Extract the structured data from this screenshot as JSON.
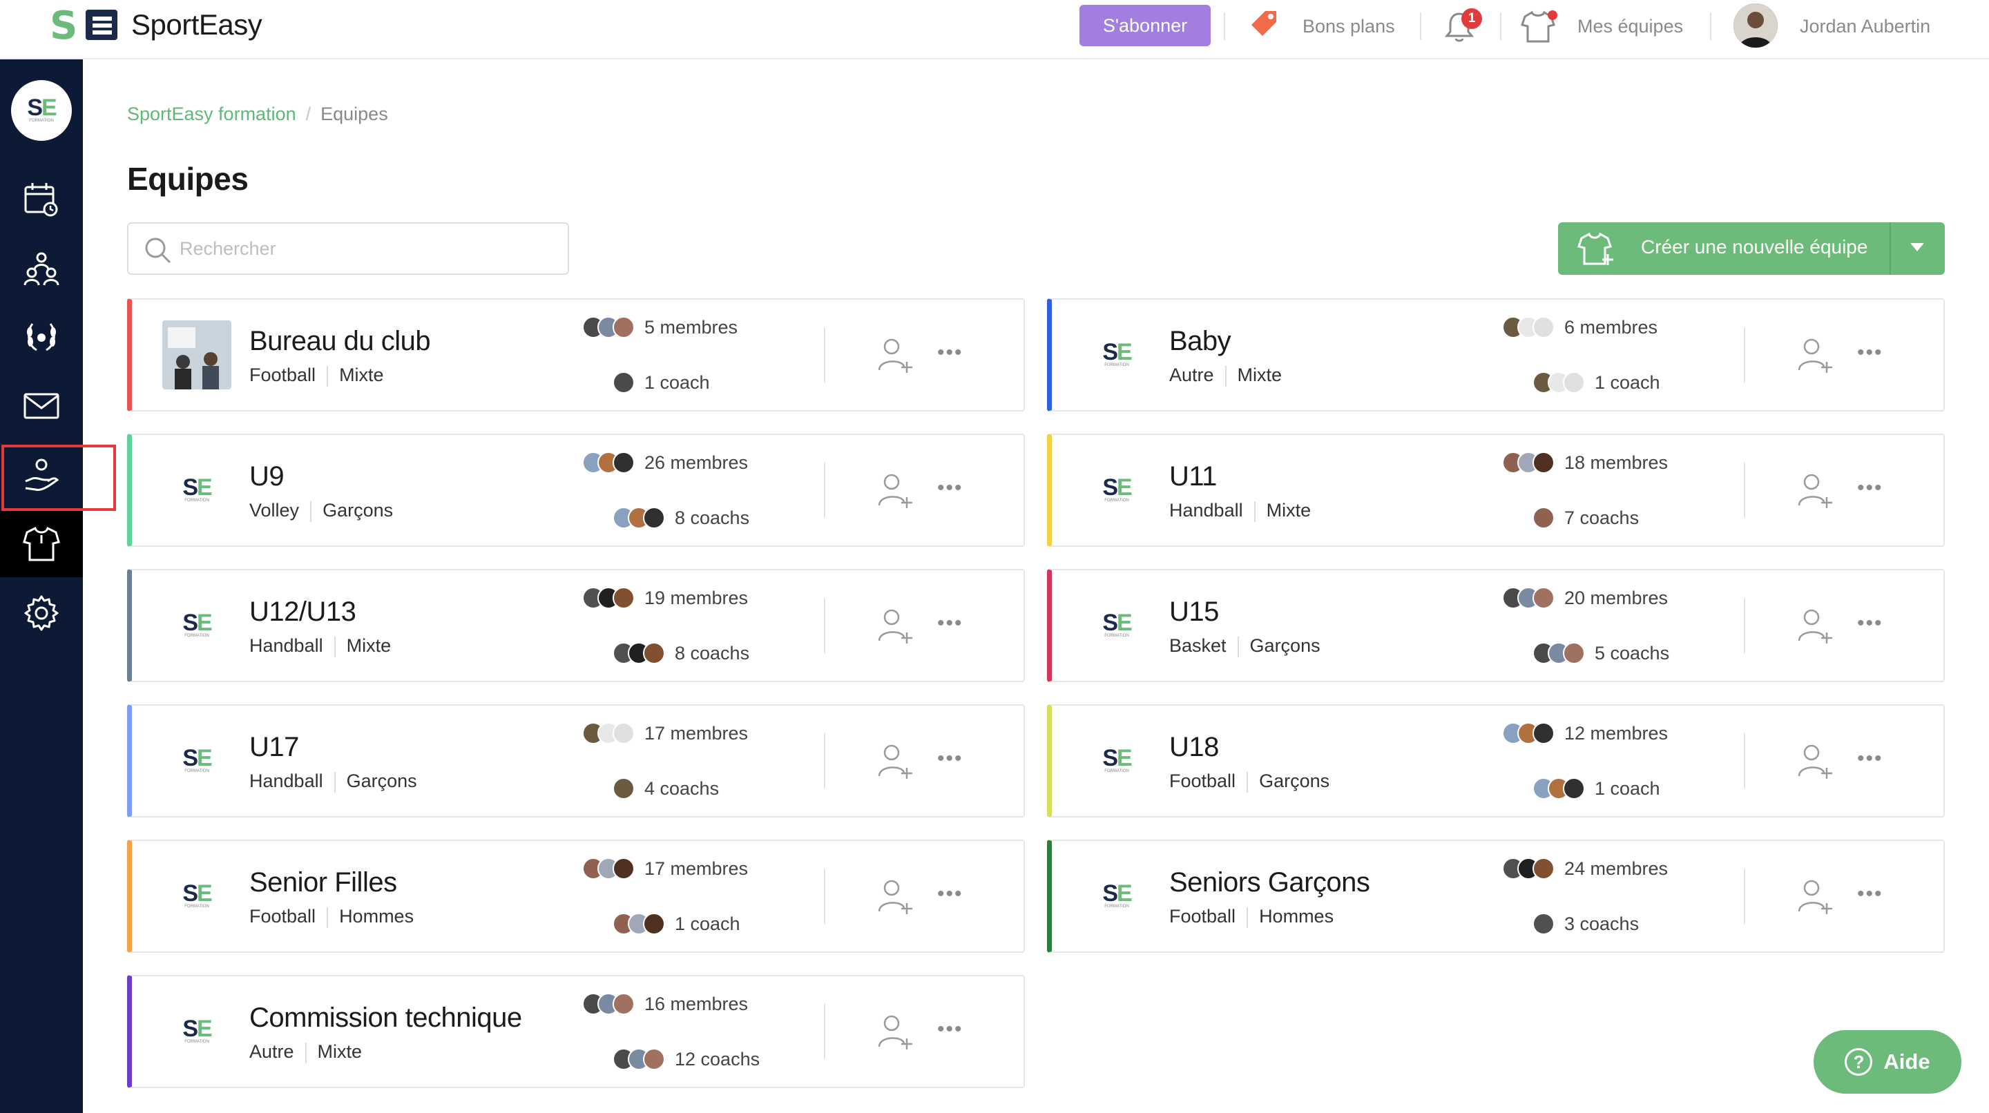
{
  "header": {
    "brand": "SportEasy",
    "subscribe_label": "S'abonner",
    "deals_label": "Bons plans",
    "notifications_count": "1",
    "teams_label": "Mes équipes",
    "user_name": "Jordan Aubertin"
  },
  "colors": {
    "accent_green": "#6dbb7b",
    "navy": "#0d1a36",
    "purple": "#a27ee0",
    "highlight_red": "#e63a3a"
  },
  "sidebar": {
    "logo_text": "SE",
    "items": [
      {
        "icon": "calendar-icon"
      },
      {
        "icon": "members-icon"
      },
      {
        "icon": "laurel-icon"
      },
      {
        "icon": "mail-icon"
      },
      {
        "icon": "hand-user-icon",
        "highlighted": true
      },
      {
        "icon": "shirt-icon",
        "active": true
      },
      {
        "icon": "gear-icon"
      }
    ]
  },
  "breadcrumb": {
    "root": "SportEasy formation",
    "current": "Equipes"
  },
  "page_title": "Equipes",
  "search": {
    "placeholder": "Rechercher",
    "value": ""
  },
  "create_button": {
    "label": "Créer une nouvelle équipe"
  },
  "logo_caption": "FORMATION",
  "teams": [
    {
      "name": "Bureau du club",
      "sport": "Football",
      "gender": "Mixte",
      "members": "5 membres",
      "coaches": "1 coach",
      "color": "#e85454",
      "photo": true
    },
    {
      "name": "Baby",
      "sport": "Autre",
      "gender": "Mixte",
      "members": "6 membres",
      "coaches": "1 coach",
      "color": "#2f5fe0"
    },
    {
      "name": "U9",
      "sport": "Volley",
      "gender": "Garçons",
      "members": "26 membres",
      "coaches": "8 coachs",
      "color": "#5fd49a"
    },
    {
      "name": "U11",
      "sport": "Handball",
      "gender": "Mixte",
      "members": "18 membres",
      "coaches": "7 coachs",
      "color": "#f4d142"
    },
    {
      "name": "U12/U13",
      "sport": "Handball",
      "gender": "Mixte",
      "members": "19 membres",
      "coaches": "8 coachs",
      "color": "#6d7f93"
    },
    {
      "name": "U15",
      "sport": "Basket",
      "gender": "Garçons",
      "members": "20 membres",
      "coaches": "5 coachs",
      "color": "#d6335c"
    },
    {
      "name": "U17",
      "sport": "Handball",
      "gender": "Garçons",
      "members": "17 membres",
      "coaches": "4 coachs",
      "color": "#7e9df5"
    },
    {
      "name": "U18",
      "sport": "Football",
      "gender": "Garçons",
      "members": "12 membres",
      "coaches": "1 coach",
      "color": "#d6e05a"
    },
    {
      "name": "Senior Filles",
      "sport": "Football",
      "gender": "Hommes",
      "members": "17 membres",
      "coaches": "1 coach",
      "color": "#f4a24a"
    },
    {
      "name": "Seniors Garçons",
      "sport": "Football",
      "gender": "Hommes",
      "members": "24 membres",
      "coaches": "3 coachs",
      "color": "#2e7d3a"
    },
    {
      "name": "Commission technique",
      "sport": "Autre",
      "gender": "Mixte",
      "members": "16 membres",
      "coaches": "12 coachs",
      "color": "#6a3fc6"
    }
  ],
  "help_button": {
    "label": "Aide"
  }
}
